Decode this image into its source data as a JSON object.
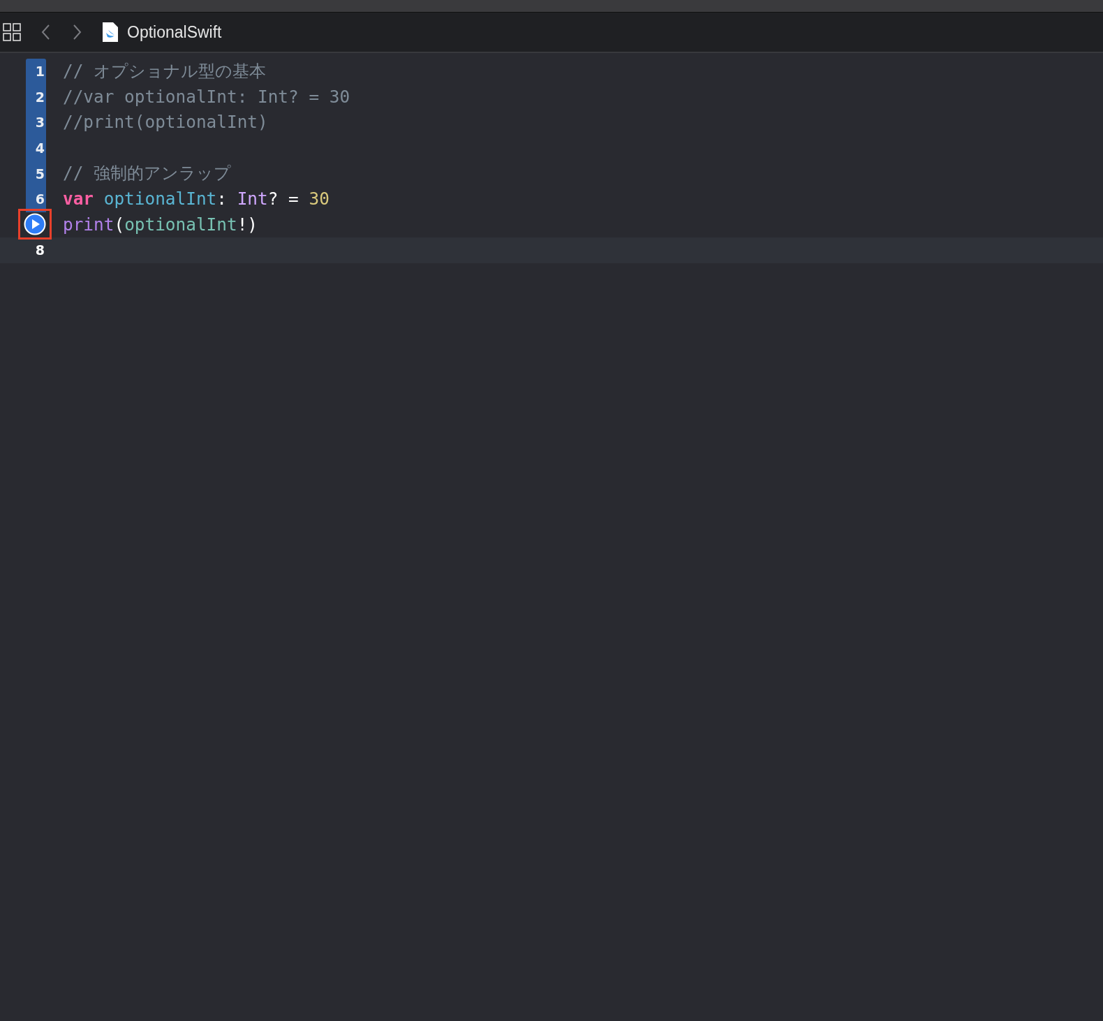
{
  "tab_bar": {
    "file_name": "OptionalSwift"
  },
  "lines": [
    {
      "number": "1",
      "executed": true,
      "current": false,
      "tokens": [
        {
          "kind": "comment",
          "text": "// オプショナル型の基本"
        }
      ]
    },
    {
      "number": "2",
      "executed": true,
      "current": false,
      "tokens": [
        {
          "kind": "comment",
          "text": "//var optionalInt: Int? = 30"
        }
      ]
    },
    {
      "number": "3",
      "executed": true,
      "current": false,
      "tokens": [
        {
          "kind": "comment",
          "text": "//print(optionalInt)"
        }
      ]
    },
    {
      "number": "4",
      "executed": true,
      "current": false
    },
    {
      "number": "5",
      "executed": true,
      "current": false,
      "tokens": [
        {
          "kind": "comment",
          "text": "// 強制的アンラップ"
        }
      ]
    },
    {
      "number": "6",
      "executed": true,
      "current": false,
      "tokens": [
        {
          "kind": "keyword",
          "text": "var"
        },
        {
          "kind": "declaration",
          "text": " optionalInt"
        },
        {
          "kind": "plain",
          "text": ": "
        },
        {
          "kind": "type",
          "text": "Int"
        },
        {
          "kind": "plain",
          "text": "? = "
        },
        {
          "kind": "number",
          "text": "30"
        }
      ]
    },
    {
      "run_button": true,
      "highlighted": true,
      "executed": false,
      "current": false,
      "tokens": [
        {
          "kind": "function",
          "text": "print"
        },
        {
          "kind": "plain",
          "text": "("
        },
        {
          "kind": "identifier",
          "text": "optionalInt"
        },
        {
          "kind": "plain",
          "text": "!)"
        }
      ]
    },
    {
      "number": "8",
      "executed": false,
      "current": true
    }
  ]
}
